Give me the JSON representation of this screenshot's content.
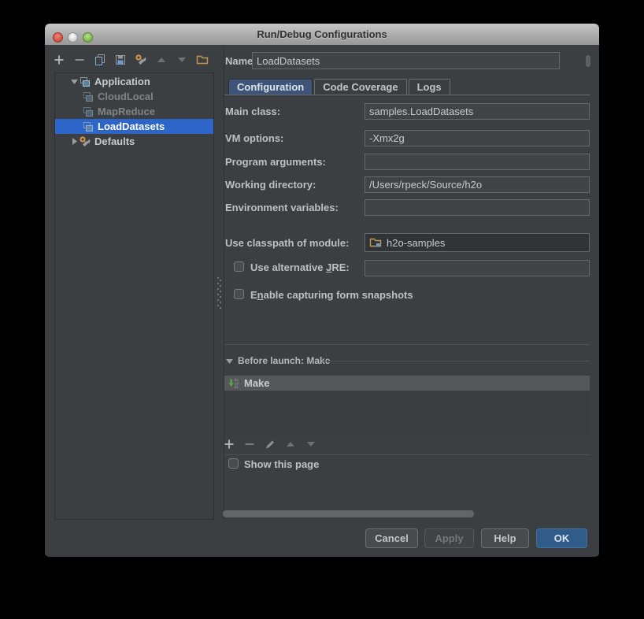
{
  "window": {
    "title": "Run/Debug Configurations"
  },
  "left_toolbar": {
    "icons": [
      "add",
      "remove",
      "copy",
      "save-all",
      "edit-defaults",
      "move-up",
      "move-down",
      "new-folder"
    ]
  },
  "tree": {
    "root": {
      "label": "Application"
    },
    "children": [
      {
        "label": "CloudLocal"
      },
      {
        "label": "MapReduce"
      },
      {
        "label": "LoadDatasets"
      }
    ],
    "defaults": {
      "label": "Defaults"
    }
  },
  "header": {
    "name_label": "Name:",
    "name_value": "LoadDatasets"
  },
  "tabs": [
    {
      "label": "Configuration"
    },
    {
      "label": "Code Coverage"
    },
    {
      "label": "Logs"
    }
  ],
  "form": {
    "rows": [
      {
        "label": "Main class:",
        "value": "samples.LoadDatasets"
      },
      {
        "label": "VM options:",
        "value": "-Xmx2g"
      },
      {
        "label": "Program arguments:",
        "value": ""
      },
      {
        "label": "Working directory:",
        "value": "/Users/rpeck/Source/h2o"
      },
      {
        "label": "Environment variables:",
        "value": ""
      }
    ],
    "module": {
      "label": "Use classpath of module:",
      "value": "h2o-samples"
    },
    "jre": {
      "pre": "Use alternative ",
      "mnemonic": "J",
      "post": "RE:",
      "value": ""
    },
    "snapshots": {
      "pre": "E",
      "mnemonic": "n",
      "post": "able capturing form snapshots"
    }
  },
  "before_launch": {
    "title": "Before launch: Make",
    "items": [
      {
        "label": "Make"
      }
    ],
    "toolbar_icons": [
      "add",
      "remove",
      "edit",
      "move-up",
      "move-down"
    ]
  },
  "footer": {
    "show_page": "Show this page",
    "cancel": "Cancel",
    "apply": "Apply",
    "help": "Help",
    "ok": "OK"
  },
  "colors": {
    "panel": "#3c3f41",
    "selection_blue": "#2e65c8",
    "tab_selected": "#3e5478",
    "ok_button": "#315b88",
    "field_bg": "#404446",
    "titlebar_text": "#303030"
  },
  "icons": {
    "add": "+",
    "remove": "−",
    "move-up": "▲",
    "move-down": "▼",
    "copy": "two-pages",
    "save-all": "floppy",
    "edit-defaults": "wrench-gear",
    "new-folder": "folder",
    "application": "overlapping-squares",
    "module": "folder-blue-square",
    "make": "green-arrow-binary",
    "edit": "pencil"
  }
}
